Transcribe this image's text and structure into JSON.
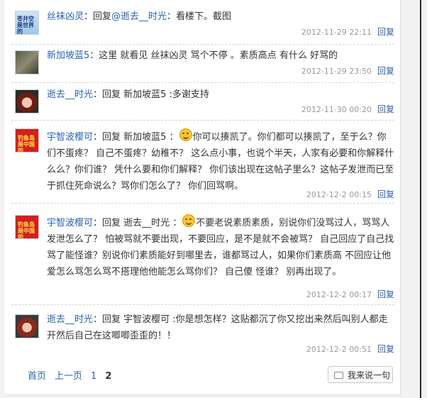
{
  "posts": [
    {
      "user": "丝袜凶灵",
      "text_a": "：回复",
      "tag": "@逝去__时光",
      "text_b": "：看楼下。截图",
      "time": "2012-11-29 22:11",
      "reply": "回复",
      "avatar_text": "苍井空\n是世界的"
    },
    {
      "user": "新加坡蓝5",
      "text_a": "：这里  就看见  丝袜凶灵  骂个不停  。素质高点  有什么  好骂的",
      "time": "2012-11-29 23:50",
      "reply": "回复"
    },
    {
      "user": "逝去__时光",
      "text_a": "：回复  新加坡蓝5  :多谢支持",
      "time": "2012-11-30 00:20",
      "reply": "回复"
    },
    {
      "user": "宇智波樱可",
      "text_a": "：回复  新加坡蓝5  ：",
      "text_b": "你可以揍凯了。你们都可以揍凯了，至于么？你们不蛋疼？  自己不蛋疼？幼稚不？  这么点小事，也说个半天，人家有必要和你解释什么么？你们谁？  凭什么要和你们解释？  你们该出现在这帖子里么？这帖子发泄而已至于抓住死命说么？骂你们怎么了？  你们回骂啊。",
      "time": "2012-12-2 00:15",
      "reply": "回复",
      "avatar_text": "钓鱼岛\n是中国的"
    },
    {
      "user": "宇智波樱可",
      "text_a": "：回复  逝去__时光  ：",
      "text_b": "不要老说素质素质，别说你们没骂过人，骂骂人发泄怎么了？  怕被骂就不要出现，不要回应，是不是就不会被骂？  自己回应了自己找骂了能怪谁？别说你们素质能好到哪里去，谁都骂过人，如果你们素质高  不回应让他爱怎么骂怎么骂不搭理他他能怎么骂你们？  自己傻  怪谁？  别再出现了。",
      "time": "2012-12-2 00:17",
      "reply": "回复",
      "avatar_text": "钓鱼岛\n是中国的"
    },
    {
      "user": "逝去__时光",
      "text_a": "：回复  宇智波樱可  :你是想怎样？这贴都沉了你又挖出来然后叫别人都走开然后自己在这唧唧歪歪的！！",
      "time": "2012-12-2 00:51",
      "reply": "回复"
    }
  ],
  "pager": {
    "first": "首页",
    "prev": "上一页",
    "p1": "1",
    "p2": "2"
  },
  "say_button": "我来说一句",
  "icons": [
    "speech-bubble-icon",
    "smiley-icon"
  ]
}
